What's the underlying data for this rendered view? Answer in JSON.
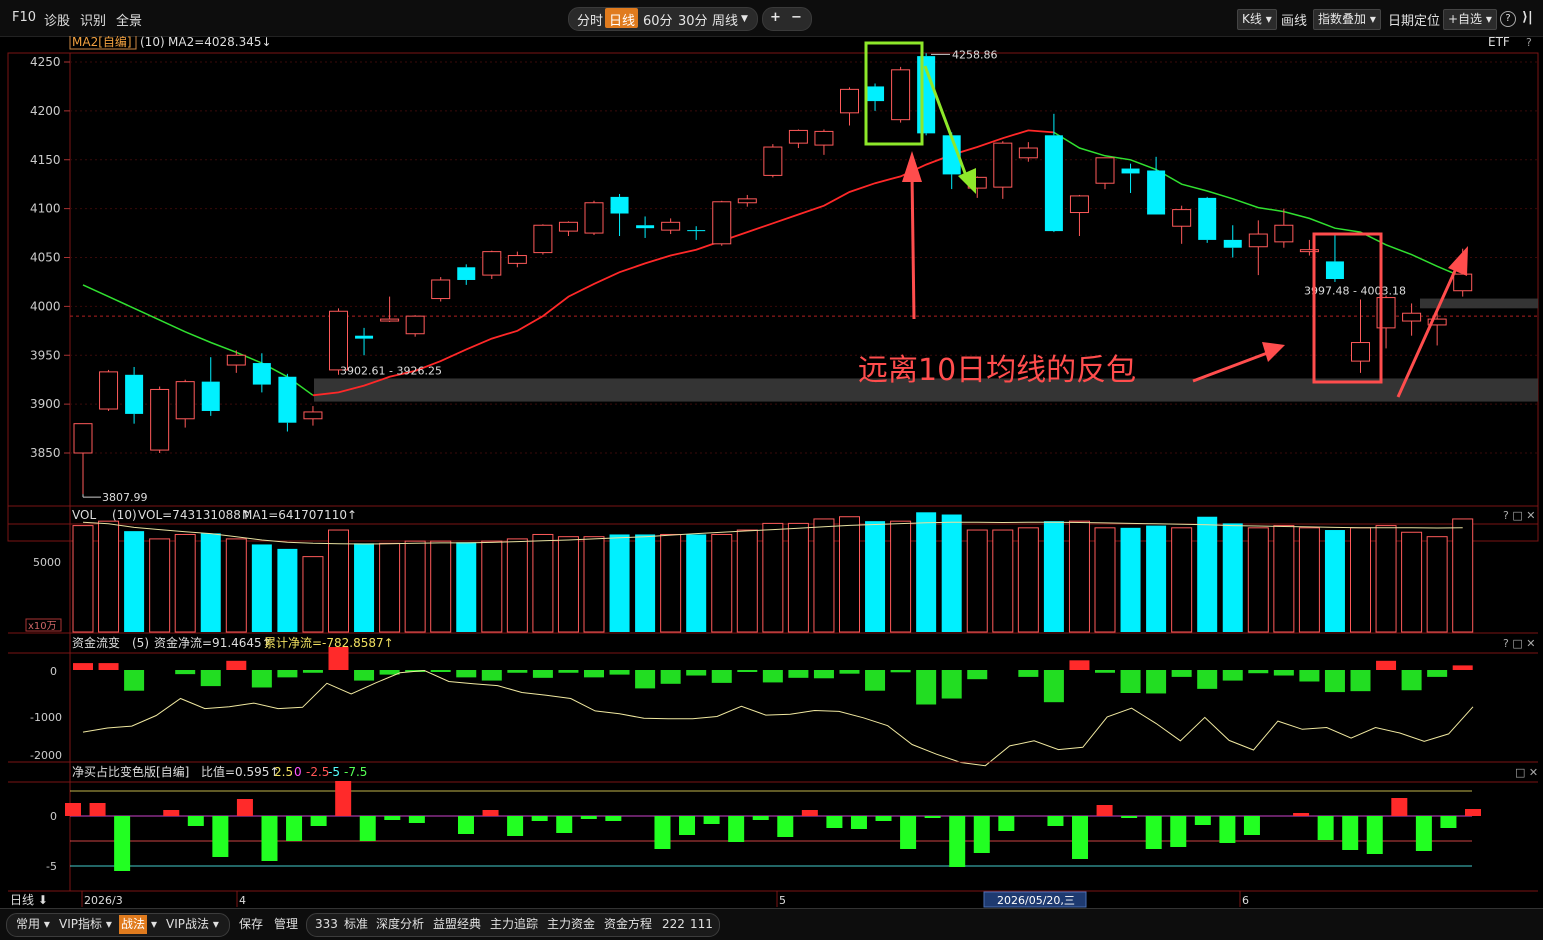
{
  "toolbar": {
    "left": [
      "F10",
      "诊股",
      "识别",
      "全景"
    ],
    "periods": [
      "分时",
      "日线",
      "60分",
      "30分",
      "周线"
    ],
    "active_period": "日线",
    "right": [
      "K线",
      "画线",
      "指数叠加",
      "日期定位",
      "+自选"
    ],
    "icons": [
      "plus-icon",
      "minus-icon",
      "help-icon",
      "collapse-icon"
    ]
  },
  "main_panel": {
    "legend_name": "MA2[自编]",
    "legend_param": "(10)",
    "legend_value": "MA2=4028.345↓",
    "etf_label": "ETF",
    "question": "?",
    "y_ticks": [
      "4250",
      "4200",
      "4150",
      "4100",
      "4050",
      "4000",
      "3950",
      "3900",
      "3850"
    ],
    "annotations": {
      "high_label": "4258.86",
      "low_label": "3807.99",
      "zone1_label": "3902.61 - 3926.25",
      "zone2_label": "3997.48 - 4003.18",
      "callout_text": "远离10日均线的反包"
    }
  },
  "vol_panel": {
    "legend_name": "VOL",
    "legend_param": "(10)",
    "legend_vol": "VOL=743131088↑",
    "legend_ma": "MA1=641707110↑",
    "y_tick": "5000",
    "unit": "x10万",
    "controls": "? □ ✕"
  },
  "flow_panel": {
    "legend_name": "资金流变",
    "legend_param": "(5)",
    "legend_net": "资金净流=91.4645↑",
    "legend_cum": "累计净流=-782.8587↑",
    "y_ticks": [
      "0",
      "-1000",
      "-2000"
    ],
    "controls": "? □ ✕"
  },
  "ratio_panel": {
    "legend_name": "净买占比变色版[自编]",
    "legend_value": "比值=0.595↑",
    "legend_levels": [
      "2.5",
      "0",
      "-2.5",
      "-5",
      "-7.5"
    ],
    "y_ticks": [
      "0",
      "-5"
    ],
    "controls": "□ ✕"
  },
  "axis": {
    "period_label": "日线",
    "months": [
      "2026/3",
      "4",
      "5",
      "6"
    ],
    "cursor_date": "2026/05/20,三"
  },
  "bottombar": {
    "items": [
      "常用",
      "VIP指标",
      "战法",
      "VIP战法",
      "保存",
      "管理",
      "333",
      "标准",
      "深度分析",
      "益盟经典",
      "主力追踪",
      "主力资金",
      "资金方程",
      "222",
      "111"
    ]
  },
  "colors": {
    "up": "#ff5a5a",
    "down": "#00f0ff",
    "ma_red": "#ff2828",
    "ma_green": "#30e030",
    "annotation_red": "#ff4d4d",
    "annotation_green": "#8ee82a",
    "active_tab": "#e07b1e"
  },
  "chart_data": [
    {
      "type": "candlestick",
      "ylim": [
        3800,
        4260
      ],
      "candles": [
        {
          "o": 3850,
          "h": 3880,
          "l": 3808,
          "c": 3880
        },
        {
          "o": 3895,
          "h": 3935,
          "l": 3893,
          "c": 3933
        },
        {
          "o": 3930,
          "h": 3938,
          "l": 3880,
          "c": 3890
        },
        {
          "o": 3853,
          "h": 3918,
          "l": 3850,
          "c": 3915
        },
        {
          "o": 3885,
          "h": 3925,
          "l": 3876,
          "c": 3923
        },
        {
          "o": 3923,
          "h": 3948,
          "l": 3888,
          "c": 3893
        },
        {
          "o": 3940,
          "h": 3955,
          "l": 3932,
          "c": 3950
        },
        {
          "o": 3942,
          "h": 3952,
          "l": 3912,
          "c": 3920
        },
        {
          "o": 3928,
          "h": 3931,
          "l": 3872,
          "c": 3881
        },
        {
          "o": 3885,
          "h": 3898,
          "l": 3878,
          "c": 3892
        },
        {
          "o": 3935,
          "h": 3998,
          "l": 3930,
          "c": 3995
        },
        {
          "o": 3970,
          "h": 3978,
          "l": 3950,
          "c": 3967
        },
        {
          "o": 3985,
          "h": 4010,
          "l": 3984,
          "c": 3987
        },
        {
          "o": 3972,
          "h": 3991,
          "l": 3969,
          "c": 3990
        },
        {
          "o": 4008,
          "h": 4030,
          "l": 4005,
          "c": 4027
        },
        {
          "o": 4040,
          "h": 4043,
          "l": 4022,
          "c": 4027
        },
        {
          "o": 4032,
          "h": 4057,
          "l": 4028,
          "c": 4056
        },
        {
          "o": 4044,
          "h": 4056,
          "l": 4040,
          "c": 4052
        },
        {
          "o": 4055,
          "h": 4084,
          "l": 4053,
          "c": 4083
        },
        {
          "o": 4077,
          "h": 4087,
          "l": 4072,
          "c": 4086
        },
        {
          "o": 4075,
          "h": 4108,
          "l": 4073,
          "c": 4106
        },
        {
          "o": 4112,
          "h": 4115,
          "l": 4072,
          "c": 4095
        },
        {
          "o": 4083,
          "h": 4092,
          "l": 4070,
          "c": 4080
        },
        {
          "o": 4078,
          "h": 4090,
          "l": 4074,
          "c": 4086
        },
        {
          "o": 4078,
          "h": 4082,
          "l": 4068,
          "c": 4077
        },
        {
          "o": 4064,
          "h": 4108,
          "l": 4062,
          "c": 4107
        },
        {
          "o": 4106,
          "h": 4114,
          "l": 4102,
          "c": 4110
        },
        {
          "o": 4134,
          "h": 4166,
          "l": 4132,
          "c": 4163
        },
        {
          "o": 4167,
          "h": 4181,
          "l": 4162,
          "c": 4180
        },
        {
          "o": 4165,
          "h": 4181,
          "l": 4155,
          "c": 4179
        },
        {
          "o": 4198,
          "h": 4224,
          "l": 4185,
          "c": 4222
        },
        {
          "o": 4225,
          "h": 4228,
          "l": 4200,
          "c": 4210
        },
        {
          "o": 4191,
          "h": 4245,
          "l": 4188,
          "c": 4242
        },
        {
          "o": 4256,
          "h": 4259,
          "l": 4175,
          "c": 4177
        },
        {
          "o": 4175,
          "h": 4178,
          "l": 4120,
          "c": 4135
        },
        {
          "o": 4121,
          "h": 4133,
          "l": 4111,
          "c": 4132
        },
        {
          "o": 4122,
          "h": 4169,
          "l": 4110,
          "c": 4167
        },
        {
          "o": 4152,
          "h": 4168,
          "l": 4148,
          "c": 4162
        },
        {
          "o": 4175,
          "h": 4197,
          "l": 4076,
          "c": 4077
        },
        {
          "o": 4096,
          "h": 4114,
          "l": 4072,
          "c": 4113
        },
        {
          "o": 4126,
          "h": 4152,
          "l": 4120,
          "c": 4152
        },
        {
          "o": 4141,
          "h": 4146,
          "l": 4116,
          "c": 4136
        },
        {
          "o": 4139,
          "h": 4153,
          "l": 4095,
          "c": 4094
        },
        {
          "o": 4082,
          "h": 4103,
          "l": 4064,
          "c": 4099
        },
        {
          "o": 4111,
          "h": 4112,
          "l": 4065,
          "c": 4068
        },
        {
          "o": 4068,
          "h": 4083,
          "l": 4050,
          "c": 4060
        },
        {
          "o": 4061,
          "h": 4088,
          "l": 4032,
          "c": 4074
        },
        {
          "o": 4066,
          "h": 4100,
          "l": 4060,
          "c": 4083
        },
        {
          "o": 4056,
          "h": 4068,
          "l": 4052,
          "c": 4058
        },
        {
          "o": 4046,
          "h": 4074,
          "l": 4025,
          "c": 4028
        },
        {
          "o": 3944,
          "h": 4007,
          "l": 3932,
          "c": 3963
        },
        {
          "o": 3978,
          "h": 4011,
          "l": 3957,
          "c": 4009
        },
        {
          "o": 3985,
          "h": 4003,
          "l": 3970,
          "c": 3993
        },
        {
          "o": 3981,
          "h": 3998,
          "l": 3960,
          "c": 3987
        },
        {
          "o": 4016,
          "h": 4059,
          "l": 4010,
          "c": 4033
        }
      ],
      "ma10": [
        4022,
        4010,
        3998,
        3986,
        3974,
        3963,
        3953,
        3942,
        3928,
        3909,
        3912,
        3919,
        3928,
        3934,
        3944,
        3956,
        3967,
        3975,
        3990,
        4010,
        4023,
        4035,
        4044,
        4052,
        4058,
        4067,
        4076,
        4085,
        4094,
        4103,
        4117,
        4126,
        4133,
        4145,
        4155,
        4163,
        4172,
        4180,
        4178,
        4162,
        4154,
        4150,
        4140,
        4125,
        4118,
        4110,
        4101,
        4097,
        4090,
        4080,
        4076,
        4063,
        4053,
        4041,
        4030
      ]
    },
    {
      "type": "bar",
      "name": "VOL",
      "values": [
        480,
        500,
        455,
        420,
        440,
        445,
        420,
        395,
        375,
        340,
        460,
        400,
        400,
        410,
        410,
        405,
        410,
        420,
        440,
        430,
        430,
        440,
        440,
        440,
        440,
        440,
        460,
        490,
        490,
        510,
        520,
        500,
        500,
        540,
        530,
        460,
        460,
        470,
        500,
        500,
        470,
        470,
        480,
        470,
        520,
        490,
        470,
        480,
        470,
        460,
        470,
        480,
        450,
        430,
        510
      ],
      "ma1": [
        495,
        488,
        472,
        462,
        452,
        444,
        430,
        415,
        405,
        400,
        398,
        397,
        398,
        400,
        402,
        402,
        404,
        408,
        412,
        415,
        420,
        425,
        430,
        437,
        444,
        450,
        456,
        462,
        468,
        475,
        481,
        485,
        489,
        493,
        495,
        495,
        494,
        495,
        495,
        494,
        492,
        490,
        488,
        486,
        484,
        480,
        478,
        476,
        474,
        472,
        470,
        470,
        470,
        469,
        470
      ],
      "y_tick": 5000
    },
    {
      "type": "bar",
      "name": "资金流变",
      "values": [
        150,
        150,
        -450,
        0,
        -90,
        -350,
        200,
        -380,
        -160,
        -60,
        500,
        -230,
        -100,
        -30,
        -20,
        -160,
        -230,
        -60,
        -170,
        -60,
        -160,
        -100,
        -400,
        -300,
        -120,
        -280,
        -40,
        -270,
        -170,
        -180,
        -80,
        -450,
        -50,
        -750,
        -620,
        -200,
        0,
        -150,
        -700,
        210,
        -60,
        -500,
        -510,
        -150,
        -410,
        -230,
        -70,
        -120,
        -250,
        -480,
        -460,
        200,
        -440,
        -150,
        100
      ],
      "line": [
        -1350,
        -1260,
        -1220,
        -990,
        -620,
        -840,
        -800,
        -720,
        -840,
        -810,
        -290,
        -520,
        -280,
        -60,
        -10,
        -250,
        -300,
        -340,
        -490,
        -550,
        -620,
        -890,
        -950,
        -1050,
        -1060,
        -1060,
        -1010,
        -790,
        -980,
        -960,
        -880,
        -900,
        -1040,
        -1210,
        -1620,
        -1830,
        -2010,
        -2080,
        -1650,
        -1540,
        -1730,
        -1680,
        -1020,
        -830,
        -1160,
        -1540,
        -1030,
        -1530,
        -1740,
        -1110,
        -1290,
        -1250,
        -1480,
        -1250,
        -1370,
        -1550,
        -1390,
        -800
      ]
    },
    {
      "type": "bar",
      "name": "净买占比",
      "values": [
        1.3,
        1.3,
        -5.5,
        0,
        0.6,
        -1,
        -4.1,
        1.7,
        -4.5,
        -2.5,
        -1,
        3.5,
        -2.5,
        -0.4,
        -0.7,
        0,
        -1.8,
        0.6,
        -2,
        -0.5,
        -1.7,
        -0.3,
        -0.5,
        0,
        -3.3,
        -1.9,
        -0.8,
        -2.6,
        -0.4,
        -2.1,
        0.6,
        -1.2,
        -1.3,
        -0.5,
        -3.3,
        -0.2,
        -5.1,
        -3.7,
        -1.5,
        0,
        -1,
        -4.3,
        1.1,
        -0.2,
        -3.3,
        -3.1,
        -0.9,
        -2.7,
        -1.9,
        0,
        0.3,
        -2.4,
        -3.4,
        -3.8,
        1.8,
        -3.5,
        -1.2,
        0.7
      ]
    }
  ]
}
